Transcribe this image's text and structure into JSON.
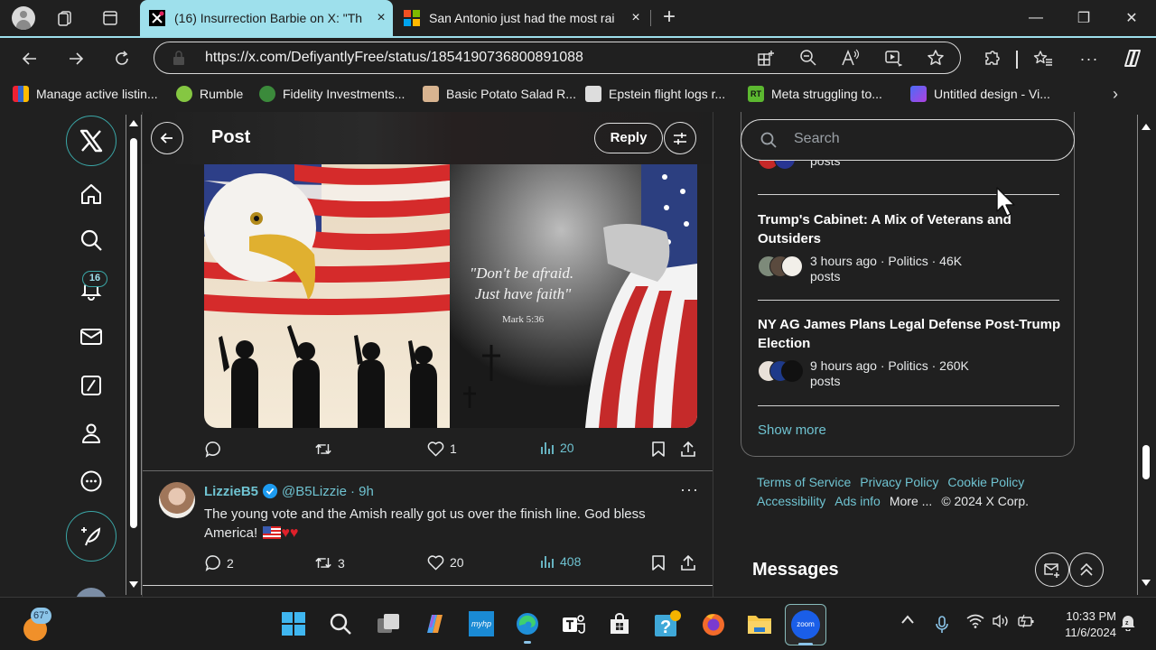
{
  "browser": {
    "tabs": [
      {
        "label": "(16) Insurrection Barbie on X: \"Th",
        "active": true,
        "favicon": "x-logo-icon"
      },
      {
        "label": "San Antonio just had the most rai",
        "active": false,
        "favicon": "microsoft-icon"
      }
    ],
    "new_tab_label": "+",
    "close_label": "×",
    "window_controls": {
      "minimize": "—",
      "restore": "❐",
      "close": "✕"
    },
    "url": "https://x.com/DefiyantlyFree/status/1854190736800891088",
    "bookmarks": [
      {
        "label": "Manage active listin...",
        "icon": "shopping-bag-icon"
      },
      {
        "label": "Rumble",
        "icon": "rumble-icon"
      },
      {
        "label": "Fidelity Investments...",
        "icon": "fidelity-icon"
      },
      {
        "label": "Basic Potato Salad R...",
        "icon": "recipe-icon"
      },
      {
        "label": "Epstein flight logs r...",
        "icon": "cloud-doc-icon"
      },
      {
        "label": "Meta struggling to...",
        "icon": "rt-icon"
      },
      {
        "label": "Untitled design - Vi...",
        "icon": "video-icon"
      }
    ]
  },
  "x": {
    "nav": {
      "notifications_badge": "16",
      "items": [
        "home",
        "explore",
        "notifications",
        "messages",
        "grok",
        "profile",
        "more"
      ]
    },
    "header": {
      "title": "Post",
      "reply_label": "Reply"
    },
    "main_post": {
      "image_caption_quote": "\"Don't be afraid. Just have faith\"",
      "image_caption_ref": "Mark 5:36",
      "stats": {
        "replies": "",
        "reposts": "",
        "likes": "1",
        "views": "20"
      }
    },
    "reply": {
      "name": "LizzieB5",
      "handle": "@B5Lizzie",
      "time": "· 9h",
      "text": "The young vote and the Amish really got us over the finish line. God bless America! ",
      "hearts": "♥♥",
      "more": "···",
      "stats": {
        "replies": "2",
        "reposts": "3",
        "likes": "20",
        "views": "408"
      }
    },
    "search": {
      "placeholder": "Search"
    },
    "trends": [
      {
        "title": "",
        "meta": "posts"
      },
      {
        "title": "Trump's Cabinet: A Mix of Veterans and Outsiders",
        "meta": "3 hours ago · Politics · 46K posts"
      },
      {
        "title": "NY AG James Plans Legal Defense Post-Trump Election",
        "meta": "9 hours ago · Politics · 260K posts"
      }
    ],
    "show_more": "Show more",
    "footer": {
      "links": [
        "Terms of Service",
        "Privacy Policy",
        "Cookie Policy",
        "Accessibility",
        "Ads info"
      ],
      "more": "More ...",
      "copyright": "© 2024 X Corp."
    },
    "messages_title": "Messages"
  },
  "taskbar": {
    "weather_temp": "67°",
    "apps": [
      "start",
      "search",
      "task-view",
      "copilot",
      "myhp",
      "edge",
      "teams",
      "store",
      "help",
      "firefox",
      "file-explorer",
      "zoom"
    ],
    "zoom_label": "zoom",
    "time": "10:33 PM",
    "date": "11/6/2024"
  },
  "colors": {
    "accent_tab": "#9ee0ec",
    "link": "#6fc3d1",
    "background": "#202020"
  }
}
